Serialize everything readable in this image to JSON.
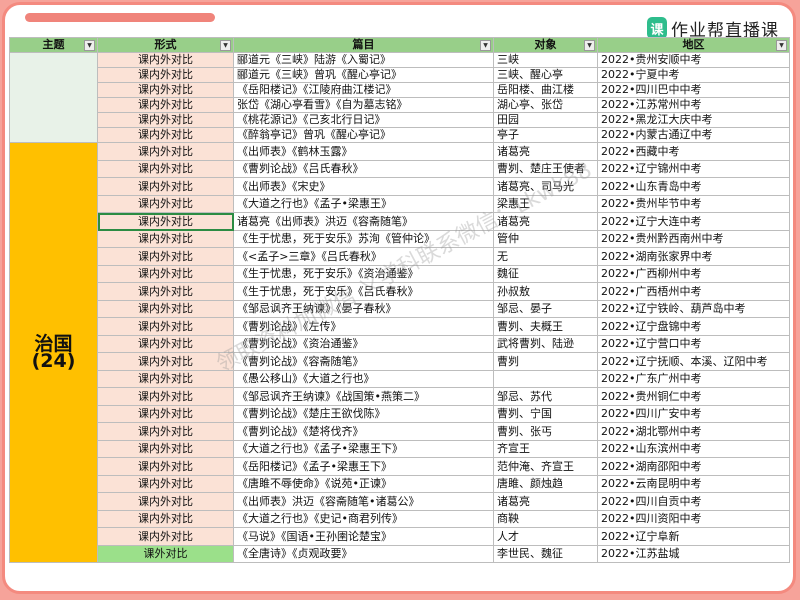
{
  "logo": {
    "mark": "课",
    "text": "作业帮直播课"
  },
  "headers": {
    "theme": "主题",
    "form": "形式",
    "title": "篇目",
    "target": "对象",
    "region": "地区"
  },
  "group1_rows": [
    {
      "form": "课内外对比",
      "title": "郦道元《三峡》陆游《入蜀记》",
      "target": "三峡",
      "region": "2022•贵州安顺中考"
    },
    {
      "form": "课内外对比",
      "title": "郦道元《三峡》曾巩《醒心亭记》",
      "target": "三峡、醒心亭",
      "region": "2022•宁夏中考"
    },
    {
      "form": "课内外对比",
      "title": "《岳阳楼记》《江陵府曲江楼记》",
      "target": "岳阳楼、曲江楼",
      "region": "2022•四川巴中中考"
    },
    {
      "form": "课内外对比",
      "title": "张岱《湖心亭看雪》《自为墓志铭》",
      "target": "湖心亭、张岱",
      "region": "2022•江苏常州中考"
    },
    {
      "form": "课内外对比",
      "title": "《桃花源记》《己亥北行日记》",
      "target": "田园",
      "region": "2022•黑龙江大庆中考"
    },
    {
      "form": "课内外对比",
      "title": "《醉翁亭记》曾巩《醒心亭记》",
      "target": "亭子",
      "region": "2022•内蒙古通辽中考"
    }
  ],
  "group2": {
    "theme_name": "治国",
    "theme_count": "(24)"
  },
  "group2_rows": [
    {
      "form": "课内外对比",
      "title": "《出师表》《鹤林玉露》",
      "target": "诸葛亮",
      "region": "2022•西藏中考"
    },
    {
      "form": "课内外对比",
      "title": "《曹刿论战》《吕氏春秋》",
      "target": "曹刿、楚庄王使者",
      "region": "2022•辽宁锦州中考"
    },
    {
      "form": "课内外对比",
      "title": "《出师表》《宋史》",
      "target": "诸葛亮、司马光",
      "region": "2022•山东青岛中考"
    },
    {
      "form": "课内外对比",
      "title": "《大道之行也》《孟子•梁惠王》",
      "target": "梁惠王",
      "region": "2022•贵州毕节中考"
    },
    {
      "form": "课内外对比",
      "title": "诸葛亮《出师表》洪迈《容斋随笔》",
      "target": "诸葛亮",
      "region": "2022•辽宁大连中考"
    },
    {
      "form": "课内外对比",
      "title": "《生于忧患，死于安乐》苏洵《管仲论》",
      "target": "管仲",
      "region": "2022•贵州黔西南州中考"
    },
    {
      "form": "课内外对比",
      "title": "《<孟子>三章》《吕氏春秋》",
      "target": "无",
      "region": "2022•湖南张家界中考"
    },
    {
      "form": "课内外对比",
      "title": "《生于忧患，死于安乐》《资治通鉴》",
      "target": "魏征",
      "region": "2022•广西柳州中考"
    },
    {
      "form": "课内外对比",
      "title": "《生于忧患，死于安乐》《吕氏春秋》",
      "target": "孙叔敖",
      "region": "2022•广西梧州中考"
    },
    {
      "form": "课内外对比",
      "title": "《邹忌讽齐王纳谏》《晏子春秋》",
      "target": "邹忌、晏子",
      "region": "2022•辽宁铁岭、葫芦岛中考"
    },
    {
      "form": "课内外对比",
      "title": "《曹刿论战》《左传》",
      "target": "曹刿、夫概王",
      "region": "2022•辽宁盘锦中考"
    },
    {
      "form": "课内外对比",
      "title": "《曹刿论战》《资治通鉴》",
      "target": "武将曹刿、陆逊",
      "region": "2022•辽宁营口中考"
    },
    {
      "form": "课内外对比",
      "title": "《曹刿论战》《容斋随笔》",
      "target": "曹刿",
      "region": "2022•辽宁抚顺、本溪、辽阳中考"
    },
    {
      "form": "课内外对比",
      "title": "《愚公移山》《大道之行也》",
      "target": "",
      "region": "2022•广东广州中考"
    },
    {
      "form": "课内外对比",
      "title": "《邹忌讽齐王纳谏》《战国策•燕策二》",
      "target": "邹忌、苏代",
      "region": "2022•贵州铜仁中考"
    },
    {
      "form": "课内外对比",
      "title": "《曹刿论战》《楚庄王欲伐陈》",
      "target": "曹刿、宁国",
      "region": "2022•四川广安中考"
    },
    {
      "form": "课内外对比",
      "title": "《曹刿论战》《楚将伐齐》",
      "target": "曹刿、张丐",
      "region": "2022•湖北鄂州中考"
    },
    {
      "form": "课内外对比",
      "title": "《大道之行也》《孟子•梁惠王下》",
      "target": "齐宣王",
      "region": "2022•山东滨州中考"
    },
    {
      "form": "课内外对比",
      "title": "《岳阳楼记》《孟子•梁惠王下》",
      "target": "范仲淹、齐宣王",
      "region": "2022•湖南邵阳中考"
    },
    {
      "form": "课内外对比",
      "title": "《唐雎不辱使命》《说苑•正谏》",
      "target": "唐雎、颜烛趋",
      "region": "2022•云南昆明中考"
    },
    {
      "form": "课内外对比",
      "title": "《出师表》洪迈《容斋随笔•诸葛公》",
      "target": "诸葛亮",
      "region": "2022•四川自贡中考"
    },
    {
      "form": "课内外对比",
      "title": "《大道之行也》《史记•商君列传》",
      "target": "商鞅",
      "region": "2022•四川资阳中考"
    },
    {
      "form": "课内外对比",
      "title": "《马说》《国语•王孙圉论楚宝》",
      "target": "人才",
      "region": "2022•辽宁阜新"
    },
    {
      "form": "课外对比",
      "title": "《全唐诗》《贞观政要》",
      "target": "李世民、魏征",
      "region": "2022•江苏盐城"
    }
  ],
  "watermark": "领取资料加微信 义学科联系微信：Lkwk88"
}
